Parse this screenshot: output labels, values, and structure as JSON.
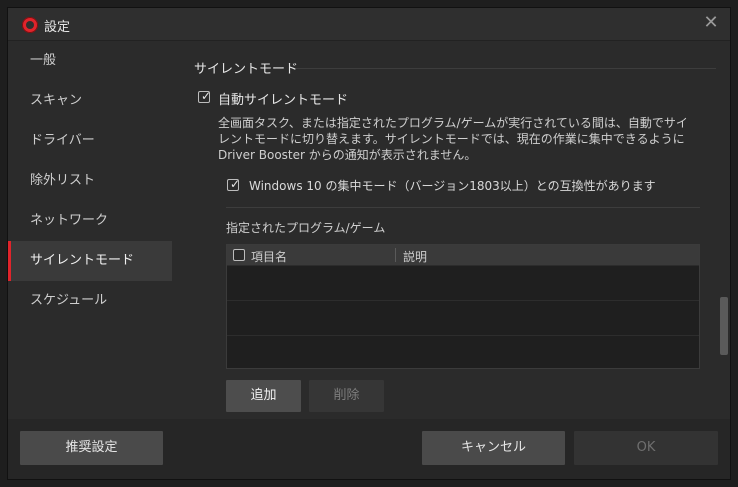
{
  "window": {
    "title": "設定"
  },
  "sidebar": {
    "items": [
      {
        "label": "一般"
      },
      {
        "label": "スキャン"
      },
      {
        "label": "ドライバー"
      },
      {
        "label": "除外リスト"
      },
      {
        "label": "ネットワーク"
      },
      {
        "label": "サイレントモード",
        "active": true
      },
      {
        "label": "スケジュール"
      }
    ]
  },
  "silent_mode": {
    "section_title": "サイレントモード",
    "auto_checkbox": {
      "label": "自動サイレントモード",
      "checked": true
    },
    "description": "全画面タスク、または指定されたプログラム/ゲームが実行されている間は、自動でサイレントモードに切り替えます。サイレントモードでは、現在の作業に集中できるように Driver Booster からの通知が表示されません。",
    "win10_checkbox": {
      "label": "Windows 10 の集中モード（バージョン1803以上）との互換性があります",
      "checked": true
    },
    "list_title": "指定されたプログラム/ゲーム",
    "table": {
      "headers": [
        "項目名",
        "説明"
      ],
      "rows": []
    },
    "add_label": "追加",
    "delete_label": "削除"
  },
  "footer": {
    "recommended_label": "推奨設定",
    "cancel_label": "キャンセル",
    "ok_label": "OK"
  }
}
